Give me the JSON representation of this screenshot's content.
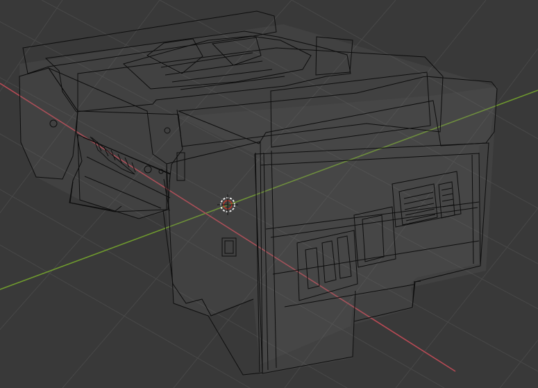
{
  "viewport": {
    "background": "#393939",
    "grid_color": "#4a4a4a",
    "x_axis_color": "#b84a55",
    "y_axis_color": "#6f9a2e",
    "wire_color": "#0b0b0b",
    "shade_color": "#6a6a6a",
    "cursor_color": "#e9e9e9",
    "cursor_accent": "#c0392b",
    "object_icon": "wireframe-printer-model",
    "cursor_icon": "3d-cursor-icon"
  }
}
